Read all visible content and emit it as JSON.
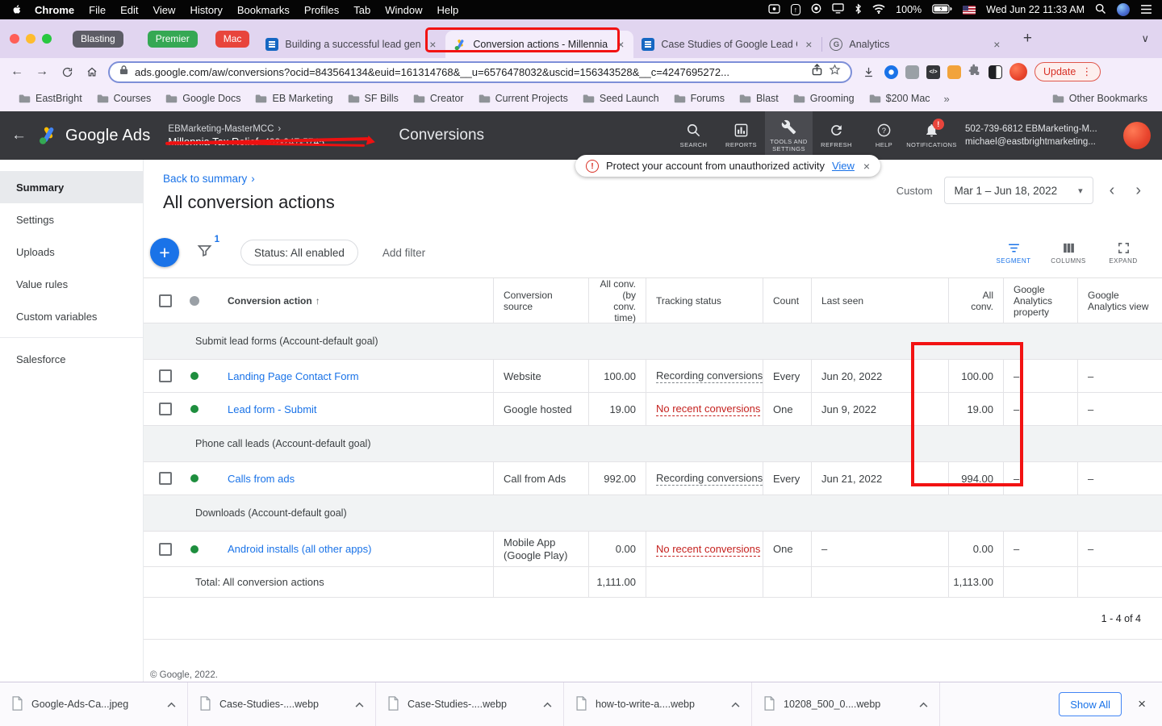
{
  "colors": {
    "accent_blue": "#1a73e8",
    "error_red": "#c5221f",
    "success_green": "#1e8e3e",
    "annotation_red": "#f21212",
    "ads_header_bg": "#37383c",
    "tabbar_purple": "#e1d5f0"
  },
  "icons": {
    "close": "×",
    "plus": "+",
    "back": "←",
    "forward": "→",
    "chevron_right": "›",
    "chevron_left": "‹",
    "caret_down": "▾",
    "chevron_down_small": "∨",
    "sort_up": "↑",
    "overflow": "»",
    "menu_dots": "⋮",
    "bang": "!",
    "favicon_g": "G"
  },
  "menubar": {
    "app_name": "Chrome",
    "items": [
      "File",
      "Edit",
      "View",
      "History",
      "Bookmarks",
      "Profiles",
      "Tab",
      "Window",
      "Help"
    ],
    "battery": "100%",
    "clock": "Wed Jun 22 11:33 AM"
  },
  "tabbar": {
    "profile_badge": "Blasting",
    "group_badges": [
      "Premier",
      "Mac"
    ],
    "tabs": [
      {
        "title": "Building a successful lead gene"
      },
      {
        "title": "Conversion actions - Millennia"
      },
      {
        "title": "Case Studies of Google Lead G"
      },
      {
        "title": "Analytics"
      }
    ]
  },
  "toolbar": {
    "url": "ads.google.com/aw/conversions?ocid=843564134&euid=161314768&__u=6576478032&uscid=156343528&__c=4247695272...",
    "update_label": "Update"
  },
  "bookmarks_bar": {
    "folders": [
      "EastBright",
      "Courses",
      "Google Docs",
      "EB Marketing",
      "SF Bills",
      "Creator",
      "Current Projects",
      "Seed Launch",
      "Forums",
      "Blast",
      "Grooming",
      "$200 Mac"
    ],
    "other_bookmarks": "Other Bookmarks"
  },
  "ads_header": {
    "product": "Google Ads",
    "mcc_account": "EBMarketing-MasterMCC",
    "sub_account": "Millennia Tax Relief",
    "sub_account_phone": "402-247-5745",
    "page_context": "Conversions",
    "nav_search": "SEARCH",
    "nav_reports": "REPORTS",
    "nav_tools": "TOOLS AND SETTINGS",
    "nav_refresh": "REFRESH",
    "nav_help": "HELP",
    "nav_notifications": "NOTIFICATIONS",
    "account_id_line": "502-739-6812 EBMarketing-M...",
    "account_email_line": "michael@eastbrightmarketing..."
  },
  "banner": {
    "message": "Protect your account from unauthorized activity",
    "action": "View"
  },
  "sidebar": {
    "items": [
      "Summary",
      "Settings",
      "Uploads",
      "Value rules",
      "Custom variables",
      "Salesforce"
    ]
  },
  "page": {
    "back_link": "Back to summary",
    "title": "All conversion actions",
    "date_label": "Custom",
    "date_range": "Mar 1 – Jun 18, 2022",
    "status_chip": "Status: All enabled",
    "add_filter": "Add filter",
    "filter_count": "1",
    "tool_segment": "SEGMENT",
    "tool_columns": "COLUMNS",
    "tool_expand": "EXPAND",
    "footer": "© Google, 2022."
  },
  "table": {
    "headers": {
      "conversion_action": "Conversion action",
      "conversion_source": "Conversion source",
      "all_conv_time": "All conv. (by conv. time)",
      "tracking_status": "Tracking status",
      "count": "Count",
      "last_seen": "Last seen",
      "all_conv": "All conv.",
      "ga_property": "Google Analytics property",
      "ga_view": "Google Analytics view"
    },
    "group1": "Submit lead forms (Account-default goal)",
    "group2": "Phone call leads (Account-default goal)",
    "group3": "Downloads (Account-default goal)",
    "rows": [
      {
        "name": "Landing Page Contact Form",
        "source": "Website",
        "all_conv_time": "100.00",
        "tracking": "Recording conversions",
        "count": "Every",
        "last_seen": "Jun 20, 2022",
        "all_conv": "100.00",
        "ga_property": "–",
        "ga_view": "–"
      },
      {
        "name": "Lead form - Submit",
        "source": "Google hosted",
        "all_conv_time": "19.00",
        "tracking": "No recent conversions",
        "count": "One",
        "last_seen": "Jun 9, 2022",
        "all_conv": "19.00",
        "ga_property": "–",
        "ga_view": "–"
      },
      {
        "name": "Calls from ads",
        "source": "Call from Ads",
        "all_conv_time": "992.00",
        "tracking": "Recording conversions",
        "count": "Every",
        "last_seen": "Jun 21, 2022",
        "all_conv": "994.00",
        "ga_property": "–",
        "ga_view": "–"
      },
      {
        "name": "Android installs (all other apps)",
        "source": "Mobile App (Google Play)",
        "all_conv_time": "0.00",
        "tracking": "No recent conversions",
        "count": "One",
        "last_seen": "–",
        "all_conv": "0.00",
        "ga_property": "–",
        "ga_view": "–"
      }
    ],
    "total_label": "Total: All conversion actions",
    "total_all_conv_time": "1,111.00",
    "total_all_conv": "1,113.00",
    "pagination": "1 - 4 of 4"
  },
  "downloads": {
    "files": [
      {
        "name": "Google-Ads-Ca...jpeg"
      },
      {
        "name": "Case-Studies-....webp"
      },
      {
        "name": "Case-Studies-....webp"
      },
      {
        "name": "how-to-write-a....webp"
      },
      {
        "name": "10208_500_0....webp"
      }
    ],
    "show_all": "Show All"
  }
}
